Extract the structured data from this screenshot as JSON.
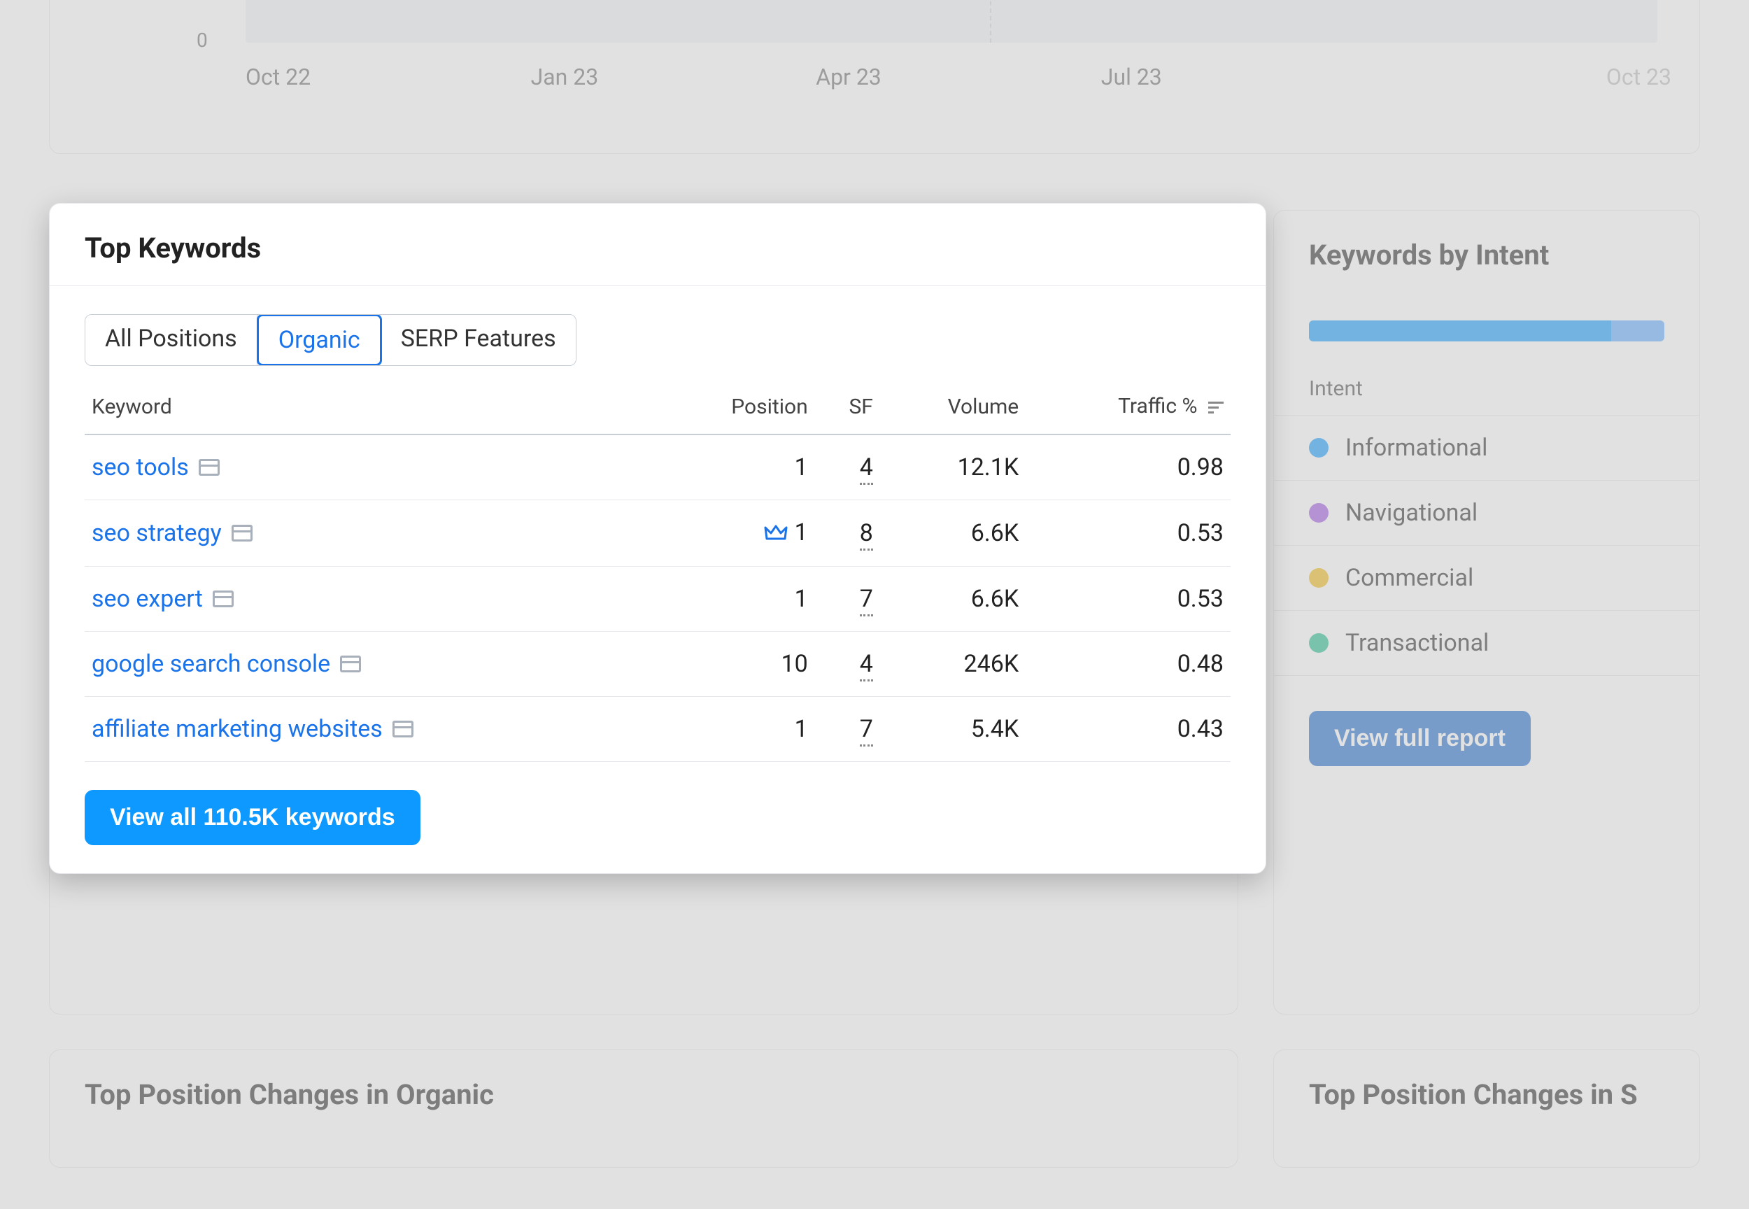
{
  "chart": {
    "zero_label": "0",
    "x_labels": [
      "Oct 22",
      "Jan 23",
      "Apr 23",
      "Jul 23",
      "Oct 23"
    ]
  },
  "top_keywords": {
    "title": "Top Keywords",
    "tabs": [
      "All Positions",
      "Organic",
      "SERP Features"
    ],
    "active_tab_index": 1,
    "columns": [
      "Keyword",
      "Position",
      "SF",
      "Volume",
      "Traffic %"
    ],
    "rows": [
      {
        "keyword": "seo tools",
        "crown": false,
        "position": "1",
        "sf": "4",
        "volume": "12.1K",
        "traffic": "0.98"
      },
      {
        "keyword": "seo strategy",
        "crown": true,
        "position": "1",
        "sf": "8",
        "volume": "6.6K",
        "traffic": "0.53"
      },
      {
        "keyword": "seo expert",
        "crown": false,
        "position": "1",
        "sf": "7",
        "volume": "6.6K",
        "traffic": "0.53"
      },
      {
        "keyword": "google search console",
        "crown": false,
        "position": "10",
        "sf": "4",
        "volume": "246K",
        "traffic": "0.48"
      },
      {
        "keyword": "affiliate marketing websites",
        "crown": false,
        "position": "1",
        "sf": "7",
        "volume": "5.4K",
        "traffic": "0.43"
      }
    ],
    "view_all_label": "View all 110.5K keywords"
  },
  "intent": {
    "title": "Keywords by Intent",
    "header": "Intent",
    "items": [
      {
        "label": "Informational",
        "color": "#0d99ff"
      },
      {
        "label": "Navigational",
        "color": "#9b51e0"
      },
      {
        "label": "Commercial",
        "color": "#f2b90e"
      },
      {
        "label": "Transactional",
        "color": "#1abc8c"
      }
    ],
    "view_full_label": "View full report"
  },
  "bottom": {
    "left_title": "Top Position Changes in Organic",
    "right_title": "Top Position Changes in S"
  }
}
